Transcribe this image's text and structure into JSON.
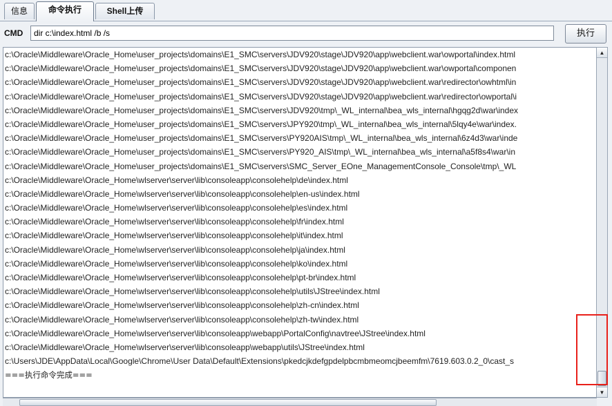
{
  "tabs": [
    {
      "label": "信息"
    },
    {
      "label": "命令执行"
    },
    {
      "label": "Shell上传"
    }
  ],
  "cmd": {
    "label": "CMD",
    "value": "dir c:\\index.html /b /s",
    "button": "执行"
  },
  "output": {
    "lines": [
      "c:\\Oracle\\Middleware\\Oracle_Home\\user_projects\\domains\\E1_SMC\\servers\\JDV920\\stage\\JDV920\\app\\webclient.war\\owportal\\index.html",
      "c:\\Oracle\\Middleware\\Oracle_Home\\user_projects\\domains\\E1_SMC\\servers\\JDV920\\stage\\JDV920\\app\\webclient.war\\owportal\\componen",
      "c:\\Oracle\\Middleware\\Oracle_Home\\user_projects\\domains\\E1_SMC\\servers\\JDV920\\stage\\JDV920\\app\\webclient.war\\redirector\\owhtml\\in",
      "c:\\Oracle\\Middleware\\Oracle_Home\\user_projects\\domains\\E1_SMC\\servers\\JDV920\\stage\\JDV920\\app\\webclient.war\\redirector\\owportal\\i",
      "c:\\Oracle\\Middleware\\Oracle_Home\\user_projects\\domains\\E1_SMC\\servers\\JDV920\\tmp\\_WL_internal\\bea_wls_internal\\hgqg2d\\war\\index",
      "c:\\Oracle\\Middleware\\Oracle_Home\\user_projects\\domains\\E1_SMC\\servers\\JPY920\\tmp\\_WL_internal\\bea_wls_internal\\5lqy4e\\war\\index.",
      "c:\\Oracle\\Middleware\\Oracle_Home\\user_projects\\domains\\E1_SMC\\servers\\PY920AIS\\tmp\\_WL_internal\\bea_wls_internal\\6z4d3\\war\\inde",
      "c:\\Oracle\\Middleware\\Oracle_Home\\user_projects\\domains\\E1_SMC\\servers\\PY920_AIS\\tmp\\_WL_internal\\bea_wls_internal\\a5f8s4\\war\\in",
      "c:\\Oracle\\Middleware\\Oracle_Home\\user_projects\\domains\\E1_SMC\\servers\\SMC_Server_EOne_ManagementConsole_Console\\tmp\\_WL",
      "c:\\Oracle\\Middleware\\Oracle_Home\\wlserver\\server\\lib\\consoleapp\\consolehelp\\de\\index.html",
      "c:\\Oracle\\Middleware\\Oracle_Home\\wlserver\\server\\lib\\consoleapp\\consolehelp\\en-us\\index.html",
      "c:\\Oracle\\Middleware\\Oracle_Home\\wlserver\\server\\lib\\consoleapp\\consolehelp\\es\\index.html",
      "c:\\Oracle\\Middleware\\Oracle_Home\\wlserver\\server\\lib\\consoleapp\\consolehelp\\fr\\index.html",
      "c:\\Oracle\\Middleware\\Oracle_Home\\wlserver\\server\\lib\\consoleapp\\consolehelp\\it\\index.html",
      "c:\\Oracle\\Middleware\\Oracle_Home\\wlserver\\server\\lib\\consoleapp\\consolehelp\\ja\\index.html",
      "c:\\Oracle\\Middleware\\Oracle_Home\\wlserver\\server\\lib\\consoleapp\\consolehelp\\ko\\index.html",
      "c:\\Oracle\\Middleware\\Oracle_Home\\wlserver\\server\\lib\\consoleapp\\consolehelp\\pt-br\\index.html",
      "c:\\Oracle\\Middleware\\Oracle_Home\\wlserver\\server\\lib\\consoleapp\\consolehelp\\utils\\JStree\\index.html",
      "c:\\Oracle\\Middleware\\Oracle_Home\\wlserver\\server\\lib\\consoleapp\\consolehelp\\zh-cn\\index.html",
      "c:\\Oracle\\Middleware\\Oracle_Home\\wlserver\\server\\lib\\consoleapp\\consolehelp\\zh-tw\\index.html",
      "c:\\Oracle\\Middleware\\Oracle_Home\\wlserver\\server\\lib\\consoleapp\\webapp\\PortalConfig\\navtree\\JStree\\index.html",
      "c:\\Oracle\\Middleware\\Oracle_Home\\wlserver\\server\\lib\\consoleapp\\webapp\\utils\\JStree\\index.html",
      "c:\\Users\\JDE\\AppData\\Local\\Google\\Chrome\\User Data\\Default\\Extensions\\pkedcjkdefgpdelpbcmbmeomcjbeemfm\\7619.603.0.2_0\\cast_s",
      "===执行命令完成==="
    ]
  },
  "icons": {
    "scroll_up": "arrow-up-icon",
    "scroll_down": "arrow-down-icon"
  },
  "colors": {
    "highlight": "#e8201a"
  }
}
